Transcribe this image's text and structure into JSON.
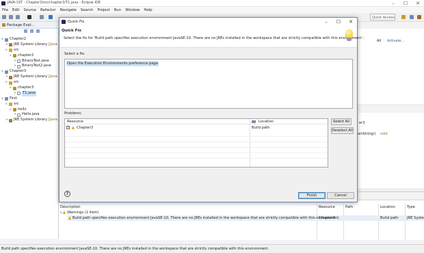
{
  "window": {
    "title": "JAVA-1ST - Chapter3/src/chapter3/T1.java - Eclipse IDE",
    "min": "–",
    "max": "☐",
    "close": "✕"
  },
  "menu": [
    "File",
    "Edit",
    "Source",
    "Refactor",
    "Navigate",
    "Search",
    "Project",
    "Run",
    "Window",
    "Help"
  ],
  "toolbar": {
    "quick_access": "Quick Access"
  },
  "package_explorer": {
    "tab_label": "Package Expl...",
    "tree": [
      {
        "indent": 0,
        "arrow": "v",
        "icon": "project",
        "label": "Chapter2",
        "sub": ""
      },
      {
        "indent": 1,
        "arrow": ">",
        "icon": "lib",
        "label": "JRE System Library",
        "sub": "[Java"
      },
      {
        "indent": 1,
        "arrow": "v",
        "icon": "folder",
        "label": "src",
        "sub": ""
      },
      {
        "indent": 2,
        "arrow": "v",
        "icon": "pkg",
        "label": "chapter2",
        "sub": ""
      },
      {
        "indent": 3,
        "arrow": ">",
        "icon": "java",
        "label": "BinaryTest.java",
        "sub": ""
      },
      {
        "indent": 3,
        "arrow": ">",
        "icon": "java",
        "label": "BinaryTest2.java",
        "sub": ""
      },
      {
        "indent": 0,
        "arrow": "v",
        "icon": "project",
        "label": "Chapter3",
        "sub": ""
      },
      {
        "indent": 1,
        "arrow": ">",
        "icon": "lib",
        "label": "JRE System Library",
        "sub": "[Java"
      },
      {
        "indent": 1,
        "arrow": "v",
        "icon": "folder",
        "label": "src",
        "sub": ""
      },
      {
        "indent": 2,
        "arrow": "v",
        "icon": "pkg",
        "label": "chapter3",
        "sub": ""
      },
      {
        "indent": 3,
        "arrow": ">",
        "icon": "java",
        "label": "T1.java",
        "sub": "",
        "selected": true
      },
      {
        "indent": 0,
        "arrow": "v",
        "icon": "project",
        "label": "First",
        "sub": ""
      },
      {
        "indent": 1,
        "arrow": "v",
        "icon": "folder",
        "label": "src",
        "sub": ""
      },
      {
        "indent": 2,
        "arrow": "v",
        "icon": "pkg",
        "label": "hello",
        "sub": ""
      },
      {
        "indent": 3,
        "arrow": ">",
        "icon": "java",
        "label": "Hello.java",
        "sub": ""
      },
      {
        "indent": 1,
        "arrow": ">",
        "icon": "lib",
        "label": "JRE System Library",
        "sub": "[Java"
      }
    ]
  },
  "outline": {
    "all_label": "All",
    "activate_label": "Activate...",
    "fragment_1": "er3",
    "fragment_2": "ainString()",
    "fragment_3": "void"
  },
  "problems_view": {
    "columns": [
      "Description",
      "Resource",
      "Path",
      "Location",
      "Type"
    ],
    "group": "Warnings (1 item)",
    "row": {
      "description": "Build path specifies execution environment JavaSE-10. There are no JREs installed in the workspace that are strictly compatible with this environment.",
      "resource": "Chapter3",
      "path": "",
      "location": "Build path",
      "type": "JRE Systen"
    }
  },
  "status_bar": {
    "message": "Build path specifies execution environment JavaSE-10. There are no JREs installed in the workspace that are strictly compatible with this environment."
  },
  "dialog": {
    "window_title": "Quick Fix",
    "heading": "Quick Fix",
    "message": "Select the fix for 'Build path specifies execution environment JavaSE-10. There are no JREs installed in the workspace that are strictly compatible with this environment.'.",
    "fix_label": "Select a fix:",
    "fixes": [
      "Open the Execution Environments preference page"
    ],
    "problems_label": "Problems:",
    "table_columns": {
      "resource": "Resource",
      "location": "Location"
    },
    "problem_rows": [
      {
        "resource": "Chapter3",
        "location": "Build path",
        "checked": true
      }
    ],
    "check_mark": "✓",
    "select_all": "Select All",
    "deselect_all": "Deselect All",
    "help_glyph": "?",
    "finish": "Finish",
    "cancel": "Cancel"
  }
}
